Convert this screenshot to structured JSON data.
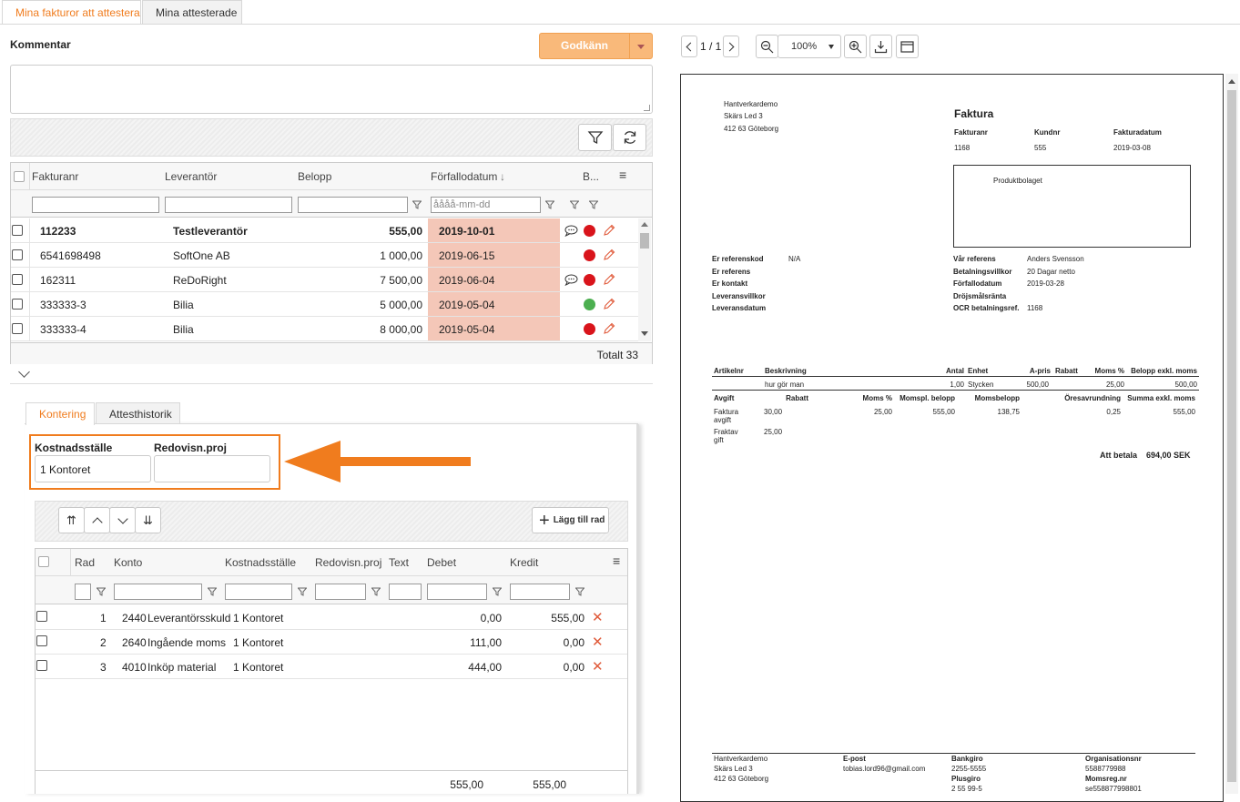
{
  "tabs": [
    "Mina fakturor att attestera",
    "Mina attesterade"
  ],
  "comment": {
    "label": "Kommentar",
    "value": ""
  },
  "approve": {
    "label": "Godkänn"
  },
  "grid": {
    "columns": [
      "Fakturanr",
      "Leverantör",
      "Belopp",
      "Förfallodatum",
      "B..."
    ],
    "date_placeholder": "åååå-mm-dd",
    "rows": [
      {
        "nr": "112233",
        "supplier": "Testleverantör",
        "amount": "555,00",
        "due": "2019-10-01",
        "comment": true,
        "status": "red",
        "bold": true
      },
      {
        "nr": "6541698498",
        "supplier": "SoftOne AB",
        "amount": "1 000,00",
        "due": "2019-06-15",
        "comment": false,
        "status": "red",
        "bold": false
      },
      {
        "nr": "162311",
        "supplier": "ReDoRight",
        "amount": "7 500,00",
        "due": "2019-06-04",
        "comment": true,
        "status": "red",
        "bold": false
      },
      {
        "nr": "333333-3",
        "supplier": "Bilia",
        "amount": "5 000,00",
        "due": "2019-05-04",
        "comment": false,
        "status": "green",
        "bold": false
      },
      {
        "nr": "333333-4",
        "supplier": "Bilia",
        "amount": "8 000,00",
        "due": "2019-05-04",
        "comment": false,
        "status": "red",
        "bold": false
      }
    ],
    "total": "Totalt 33"
  },
  "subtabs": [
    "Kontering",
    "Attesthistorik"
  ],
  "kontering": {
    "kst_label": "Kostnadsställe",
    "kst_value": "1 Kontoret",
    "proj_label": "Redovisn.proj",
    "proj_value": "",
    "add_row": "Lägg till rad",
    "columns": [
      "Rad",
      "Konto",
      "Kostnadsställe",
      "Redovisn.proj",
      "Text",
      "Debet",
      "Kredit"
    ],
    "rows": [
      {
        "rad": "1",
        "konto": "2440",
        "name": "Leverantörsskuld",
        "kst": "1 Kontoret",
        "debet": "0,00",
        "kredit": "555,00"
      },
      {
        "rad": "2",
        "konto": "2640",
        "name": "Ingående moms",
        "kst": "1 Kontoret",
        "debet": "111,00",
        "kredit": "0,00"
      },
      {
        "rad": "3",
        "konto": "4010",
        "name": "Inköp material",
        "kst": "1 Kontoret",
        "debet": "444,00",
        "kredit": "0,00"
      }
    ],
    "sum_debet": "555,00",
    "sum_kredit": "555,00"
  },
  "viewer": {
    "page": "1 / 1",
    "zoom": "100%"
  },
  "invoice": {
    "sender": [
      "Hantverkardemo",
      "Skärs Led 3",
      "412 63 Göteborg"
    ],
    "title": "Faktura",
    "h_labels": [
      "Fakturanr",
      "Kundnr",
      "Fakturadatum"
    ],
    "h_values": [
      "1168",
      "555",
      "2019-03-08"
    ],
    "recipient": "Produktbolaget",
    "left_labels": [
      "Er referenskod",
      "Er referens",
      "Er kontakt",
      "Leveransvillkor",
      "Leveransdatum"
    ],
    "left_values": [
      "N/A",
      "",
      "",
      "",
      ""
    ],
    "right_labels": [
      "Vår referens",
      "Betalningsvillkor",
      "Förfallodatum",
      "Dröjsmålsränta",
      "OCR betalningsref."
    ],
    "right_values": [
      "Anders Svensson",
      "20 Dagar netto",
      "2019-03-28",
      "",
      "1168"
    ],
    "line_headers": [
      "Artikelnr",
      "Beskrivning",
      "Antal",
      "Enhet",
      "A-pris",
      "Rabatt",
      "Moms %",
      "Belopp exkl. moms"
    ],
    "line": [
      "",
      "hur gör man",
      "1,00",
      "Stycken",
      "500,00",
      "",
      "25,00",
      "500,00"
    ],
    "fee_headers": [
      "Avgift",
      "Rabatt",
      "Moms %",
      "Momspl. belopp",
      "Momsbelopp",
      "Öresavrundning",
      "Summa exkl. moms"
    ],
    "fee_rows": [
      [
        "Faktura avgift",
        "30,00",
        "25,00",
        "555,00",
        "138,75",
        "0,25",
        "555,00"
      ],
      [
        "Fraktav gift",
        "25,00"
      ]
    ],
    "fee_row_label_parts": [
      [
        "Faktura",
        "avgift"
      ],
      [
        "Fraktav",
        "gift"
      ]
    ],
    "to_pay_label": "Att betala",
    "to_pay_value": "694,00 SEK",
    "footer": {
      "addr": [
        "Hantverkardemo",
        "Skärs Led 3",
        "412 63 Göteborg"
      ],
      "email_label": "E-post",
      "email": "tobias.lord96@gmail.com",
      "bankgiro_label": "Bankgiro",
      "bankgiro": "2255-5555",
      "plusgiro_label": "Plusgiro",
      "plusgiro": "2 55 99-5",
      "org_label": "Organisationsnr",
      "org": "5588779988",
      "moms_label": "Momsreg.nr",
      "moms": "se558877998801"
    }
  },
  "colors": {
    "accent": "#f07c1e",
    "overdue": "#f4c7b8",
    "red": "#d9141b",
    "green": "#4caf50"
  }
}
